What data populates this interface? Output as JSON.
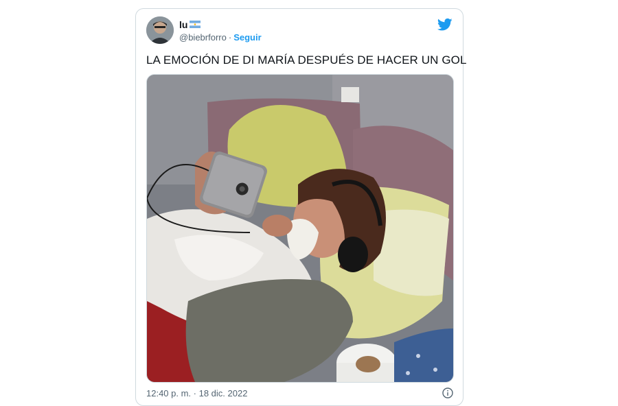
{
  "tweet": {
    "display_name": "lu",
    "flag_emoji": "🇦🇷",
    "handle": "@biebrforro",
    "separator": "·",
    "follow_label": "Seguir",
    "text": "LA EMOCIÓN DE DI MARÍA DESPUÉS DE HACER UN GOL",
    "timestamp": "12:40 p. m. · 18 dic. 2022",
    "icons": {
      "brand": "twitter-bird-icon",
      "info": "info-icon"
    },
    "colors": {
      "accent": "#1d9bf0",
      "text": "#0f1419",
      "secondary": "#536471",
      "border": "#cfd9de"
    }
  }
}
